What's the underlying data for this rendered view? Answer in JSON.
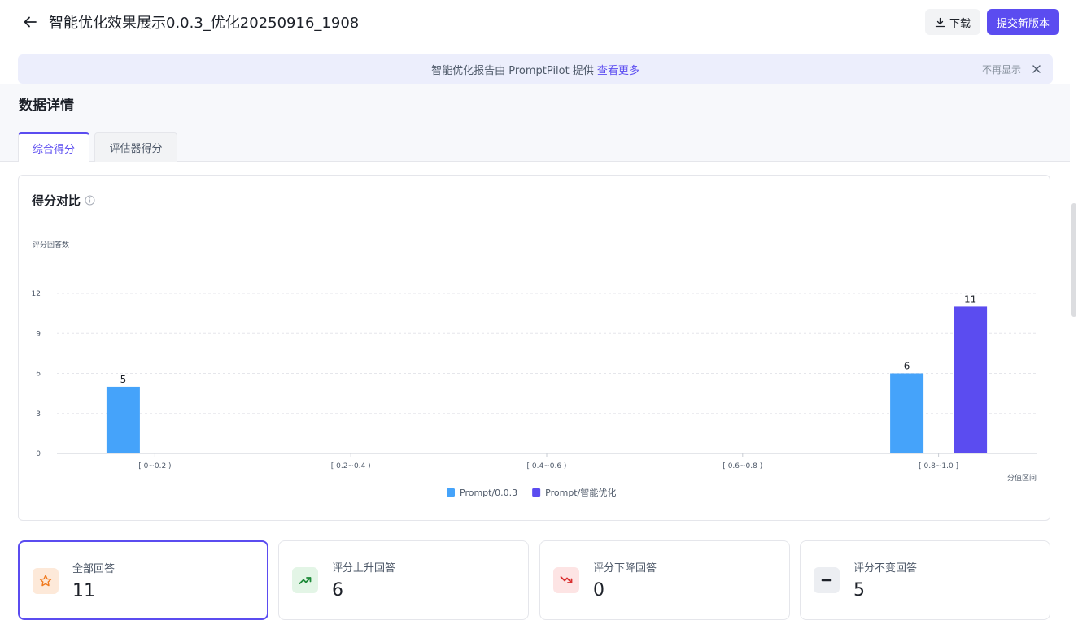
{
  "header": {
    "title": "智能优化效果展示0.0.3_优化20250916_1908",
    "download_label": "下载",
    "submit_label": "提交新版本"
  },
  "banner": {
    "text": "智能优化报告由 PromptPilot 提供",
    "link": "查看更多",
    "dismiss": "不再显示"
  },
  "section": {
    "title": "数据详情",
    "tabs": [
      {
        "label": "综合得分",
        "active": true
      },
      {
        "label": "评估器得分",
        "active": false
      }
    ]
  },
  "chart_card": {
    "title": "得分对比"
  },
  "chart_data": {
    "type": "bar",
    "ylabel": "评分回答数",
    "xlabel": "分值区间",
    "ylim": [
      0,
      12
    ],
    "yticks": [
      0,
      3,
      6,
      9,
      12
    ],
    "categories": [
      "[ 0~0.2 )",
      "[ 0.2~0.4 )",
      "[ 0.4~0.6 )",
      "[ 0.6~0.8 )",
      "[ 0.8~1.0 ]"
    ],
    "series": [
      {
        "name": "Prompt/0.0.3",
        "color": "#45a3fa",
        "values": [
          5,
          0,
          0,
          0,
          6
        ]
      },
      {
        "name": "Prompt/智能优化",
        "color": "#5b4cf0",
        "values": [
          0,
          0,
          0,
          0,
          11
        ]
      }
    ],
    "legend": "bottom-center",
    "grid": true
  },
  "stats": [
    {
      "label": "全部回答",
      "value": "11",
      "icon": "star-icon",
      "active": true
    },
    {
      "label": "评分上升回答",
      "value": "6",
      "icon": "trend-up-icon",
      "active": false
    },
    {
      "label": "评分下降回答",
      "value": "0",
      "icon": "trend-down-icon",
      "active": false
    },
    {
      "label": "评分不变回答",
      "value": "5",
      "icon": "minus-icon",
      "active": false
    }
  ]
}
